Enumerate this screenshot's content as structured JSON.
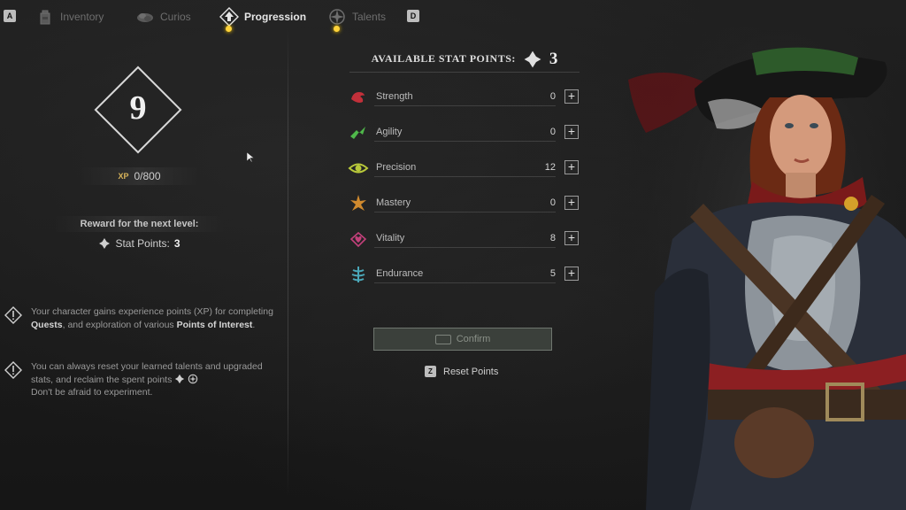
{
  "nav": {
    "left_key": "A",
    "right_key": "D",
    "tabs": [
      {
        "label": "Inventory",
        "icon": "backpack-icon",
        "active": false
      },
      {
        "label": "Curios",
        "icon": "curios-icon",
        "active": false
      },
      {
        "label": "Progression",
        "icon": "progression-arrow-icon",
        "active": true
      },
      {
        "label": "Talents",
        "icon": "talents-compass-icon",
        "active": false
      }
    ]
  },
  "level": {
    "value": "9",
    "xp_badge": "XP",
    "xp": "0/800",
    "reward_title": "Reward for the next level:",
    "reward_label": "Stat Points:",
    "reward_value": "3"
  },
  "hints": [
    {
      "pre": "Your character gains experience points (XP) for completing ",
      "b1": "Quests",
      "mid": ", and exploration of various ",
      "b2": "Points of Interest",
      "post": "."
    },
    {
      "line1": "You can always reset your learned talents and upgraded stats, and reclaim the spent points",
      "line2": "Don't be afraid to experiment."
    }
  ],
  "stats": {
    "available_label": "AVAILABLE STAT POINTS:",
    "available_value": "3",
    "items": [
      {
        "name": "Strength",
        "value": "0",
        "icon": "strength-icon",
        "color": "#c2303a"
      },
      {
        "name": "Agility",
        "value": "0",
        "icon": "agility-icon",
        "color": "#4fb84a"
      },
      {
        "name": "Precision",
        "value": "12",
        "icon": "precision-eye-icon",
        "color": "#b9c93a"
      },
      {
        "name": "Mastery",
        "value": "0",
        "icon": "mastery-icon",
        "color": "#d08a2e"
      },
      {
        "name": "Vitality",
        "value": "8",
        "icon": "vitality-heart-icon",
        "color": "#c2407a"
      },
      {
        "name": "Endurance",
        "value": "5",
        "icon": "endurance-icon",
        "color": "#4aa7b8"
      }
    ]
  },
  "actions": {
    "confirm": "Confirm",
    "reset_key": "Z",
    "reset": "Reset Points"
  }
}
